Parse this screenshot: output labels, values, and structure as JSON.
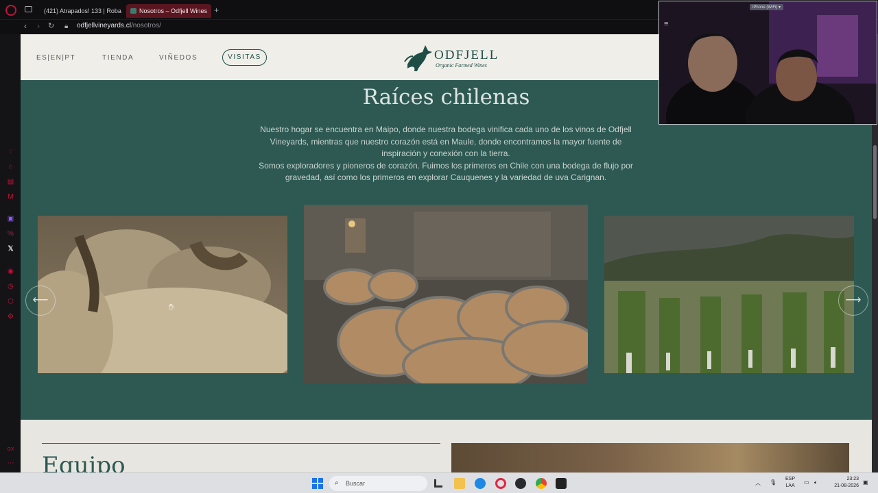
{
  "browser": {
    "tabs": [
      {
        "label": "(421) Atrapados! 133 | Roba",
        "favicon": "youtube-icon",
        "active": false
      },
      {
        "label": "Nosotros – Odfjell Wines",
        "favicon": "odfjell-icon",
        "active": true
      }
    ],
    "url_host": "odfjellvineyards.cl",
    "url_path": "/nosotros/"
  },
  "site": {
    "languages": "ES|EN|PT",
    "nav": [
      "TIENDA",
      "VIÑEDOS"
    ],
    "cta": "VISITAS",
    "logo_name": "ODFJELL",
    "logo_tagline": "Organic Farmed Wines"
  },
  "hero": {
    "title": "Raíces chilenas",
    "paragraph_1": "Nuestro hogar se encuentra en Maipo, donde nuestra bodega vinifica cada uno de los vinos de Odfjell Vineyards, mientras que nuestro corazón está en Maule, donde encontramos la mayor fuente de inspiración y conexión con la tierra.",
    "paragraph_2": "Somos exploradores y pioneros de corazón. Fuimos los primeros en Chile con una bodega de flujo por gravedad, así como los primeros en explorar Cauquenes y la variedad de uva Carignan."
  },
  "carousel": {
    "prev_icon": "arrow-left-icon",
    "next_icon": "arrow-right-icon",
    "prev_glyph": "⟵",
    "next_glyph": "⟶"
  },
  "team": {
    "heading": "Equipo"
  },
  "webcam": {
    "device_label": "iPhone (WiFi) ▾"
  },
  "taskbar": {
    "search_placeholder": "Buscar",
    "lang_line1": "ESP",
    "lang_line2": "LAA",
    "time": "23:23",
    "date": "21-08-2026"
  },
  "colors": {
    "brand_green": "#2e5953",
    "opera_red": "#c0153a"
  }
}
